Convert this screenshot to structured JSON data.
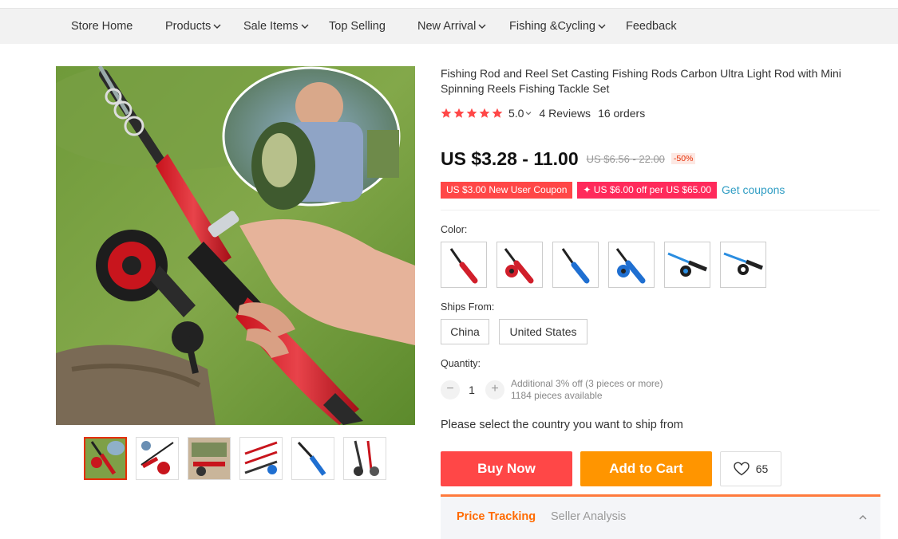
{
  "nav": {
    "items": [
      {
        "label": "Store Home",
        "dropdown": false
      },
      {
        "label": "Products",
        "dropdown": true
      },
      {
        "label": "Sale Items",
        "dropdown": true
      },
      {
        "label": "Top Selling",
        "dropdown": false
      },
      {
        "label": "New Arrival",
        "dropdown": true
      },
      {
        "label": "Fishing &Cycling",
        "dropdown": true
      },
      {
        "label": "Feedback",
        "dropdown": false
      }
    ]
  },
  "product": {
    "title": "Fishing Rod and Reel Set Casting Fishing Rods Carbon Ultra Light Rod with Mini Spinning Reels Fishing Tackle Set",
    "rating": "5.0",
    "stars": 5,
    "reviews": "4 Reviews",
    "orders": "16 orders",
    "price": "US $3.28 - 11.00",
    "original_price": "US $6.56 - 22.00",
    "discount": "-50%",
    "coupons": [
      "US $3.00 New User Coupon",
      "✦ US $6.00 off per US $65.00"
    ],
    "get_coupons": "Get coupons",
    "color_label": "Color:",
    "colors": [
      {
        "name": "red-rod",
        "accent": "#d11f2b"
      },
      {
        "name": "red-rod-with-reel",
        "accent": "#d11f2b"
      },
      {
        "name": "blue-rod",
        "accent": "#1f6fd1"
      },
      {
        "name": "blue-rod-with-reel",
        "accent": "#1f6fd1"
      },
      {
        "name": "blue-rod-set",
        "accent": "#2a8de0"
      },
      {
        "name": "blue-rod-set-2",
        "accent": "#2a8de0"
      }
    ],
    "ships_from_label": "Ships From:",
    "ships_from": [
      "China",
      "United States"
    ],
    "quantity_label": "Quantity:",
    "quantity": "1",
    "quantity_note_1": "Additional 3% off (3 pieces or more)",
    "quantity_note_2": "1184 pieces available",
    "ship_message": "Please select the country you want to ship from",
    "buy_now": "Buy Now",
    "add_to_cart": "Add to Cart",
    "wishlist_count": "65"
  },
  "tracking": {
    "tabs": [
      "Price Tracking",
      "Seller Analysis"
    ]
  },
  "colors": {
    "accent_red": "#ff4747",
    "accent_orange": "#ff9500",
    "star": "#ff4747",
    "link": "#2e9cc3",
    "tab_active": "#ff6a00"
  }
}
